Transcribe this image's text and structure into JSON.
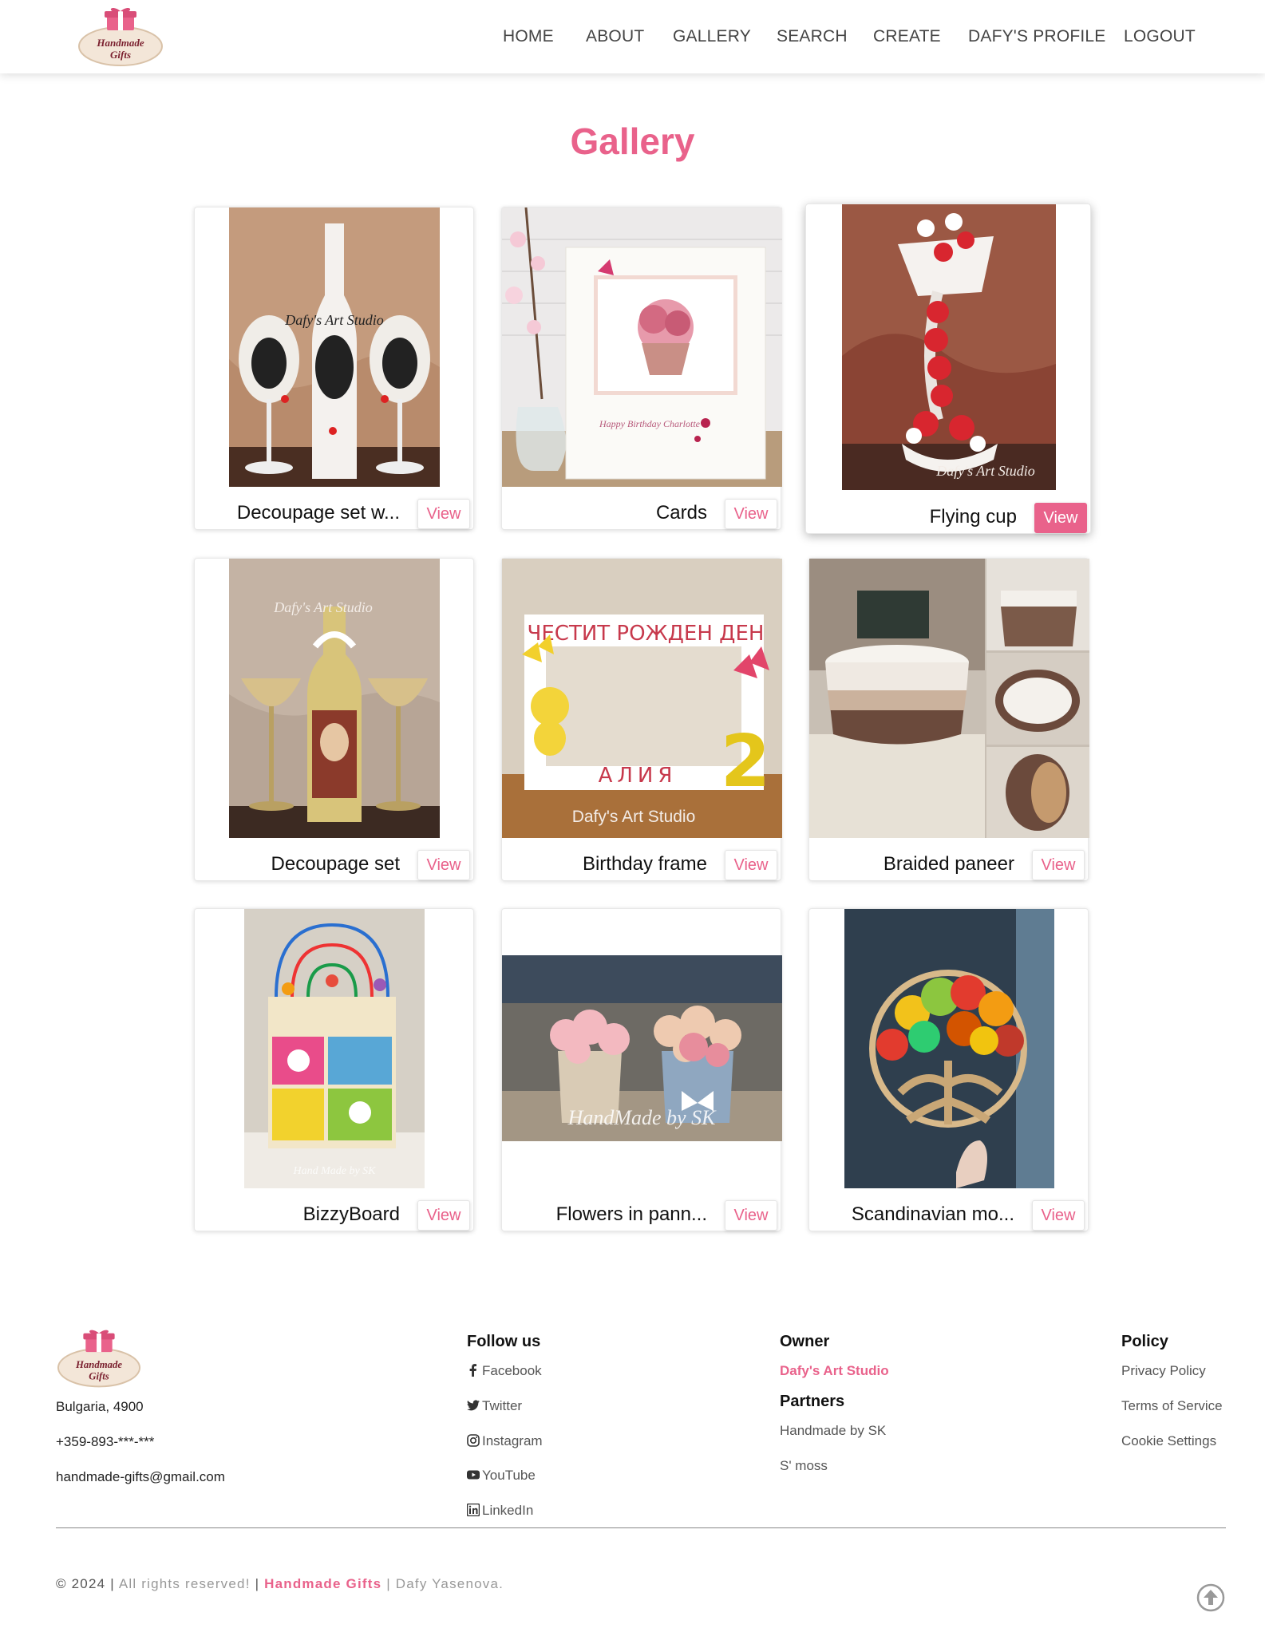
{
  "brand": {
    "logo_line1": "Handmade",
    "logo_line2": "Gifts",
    "accent_color": "#e9628b"
  },
  "nav": {
    "items": [
      "HOME",
      "ABOUT",
      "GALLERY",
      "SEARCH",
      "CREATE",
      "DAFY'S PROFILE",
      "LOGOUT"
    ]
  },
  "gallery": {
    "title": "Gallery",
    "view_label": "View",
    "items": [
      {
        "name": "Decoupage set w...",
        "image_text": "Dafy's Art Studio",
        "image_icon": "decoupage-bottle-glasses-photo"
      },
      {
        "name": "Cards",
        "image_text": "Happy Birthday Charlotte",
        "image_icon": "birthday-card-photo"
      },
      {
        "name": "Flying cup",
        "image_text": "Dafy's Art Studio",
        "image_icon": "flying-cup-roses-photo"
      },
      {
        "name": "Decoupage set",
        "image_text": "Dafy's Art Studio",
        "image_icon": "decoupage-icon-bottle-photo"
      },
      {
        "name": "Birthday frame",
        "image_text": "Dafy's Art Studio",
        "image_top_text": "ЧЕСТИТ РОЖДЕН ДЕН",
        "image_bottom_text": "АЛИЯ",
        "image_number": "2",
        "image_icon": "birthday-frame-photo"
      },
      {
        "name": "Braided paneer",
        "image_icon": "braided-basket-photo"
      },
      {
        "name": "BizzyBoard",
        "image_text": "Hand Made by SK",
        "image_icon": "busy-board-photo"
      },
      {
        "name": "Flowers in pann...",
        "image_text": "HandMade by SK",
        "image_icon": "flower-baskets-photo"
      },
      {
        "name": "Scandinavian mo...",
        "image_icon": "moss-tree-of-life-photo"
      }
    ]
  },
  "footer": {
    "address": "Bulgaria, 4900",
    "phone": "+359-893-***-***",
    "email": "handmade-gifts@gmail.com",
    "follow_heading": "Follow us",
    "social": [
      {
        "label": "Facebook",
        "icon": "facebook-icon"
      },
      {
        "label": "Twitter",
        "icon": "twitter-icon"
      },
      {
        "label": "Instagram",
        "icon": "instagram-icon"
      },
      {
        "label": "YouTube",
        "icon": "youtube-icon"
      },
      {
        "label": "LinkedIn",
        "icon": "linkedin-icon"
      }
    ],
    "owner_heading": "Owner",
    "owner_name": "Dafy's Art Studio",
    "partners_heading": "Partners",
    "partners": [
      "Handmade by SK",
      "S' moss"
    ],
    "policy_heading": "Policy",
    "policy_links": [
      "Privacy Policy",
      "Terms of Service",
      "Cookie Settings"
    ],
    "copyright_year": "© 2024",
    "copyright_sep1": "|",
    "copyright_rights": "All rights reserved!",
    "copyright_sep2": "|",
    "copyright_brand": "Handmade Gifts",
    "copyright_sep3": "|",
    "copyright_author": "Dafy Yasenova."
  }
}
